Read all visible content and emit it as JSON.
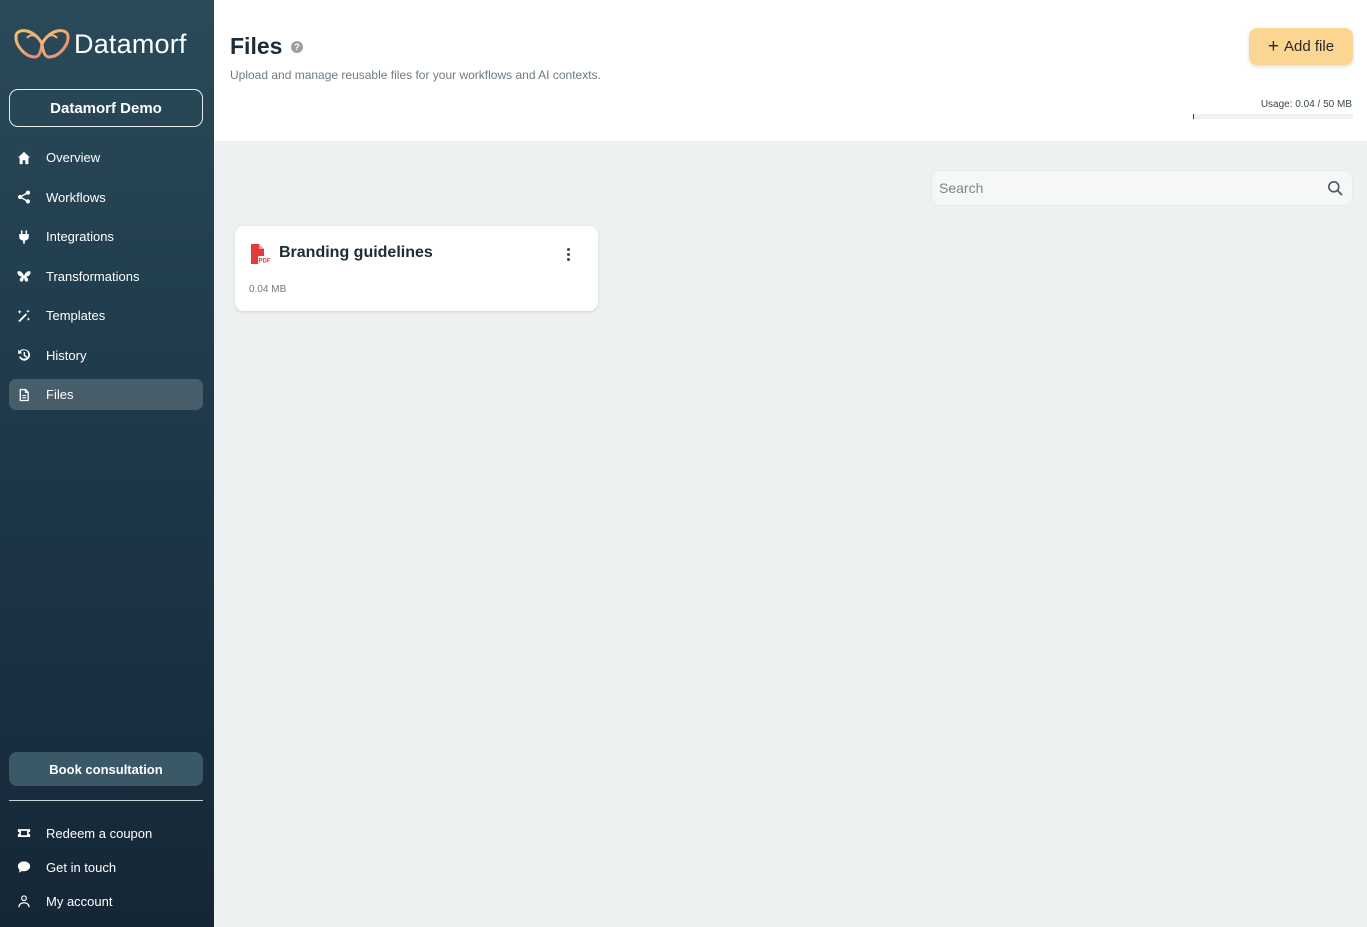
{
  "app": {
    "name": "Datamorf"
  },
  "organization": {
    "name": "Datamorf Demo"
  },
  "sidebar": {
    "items": [
      {
        "label": "Overview",
        "icon": "home-icon"
      },
      {
        "label": "Workflows",
        "icon": "share-icon"
      },
      {
        "label": "Integrations",
        "icon": "plug-icon"
      },
      {
        "label": "Transformations",
        "icon": "butterfly-icon"
      },
      {
        "label": "Templates",
        "icon": "magic-wand-icon"
      },
      {
        "label": "History",
        "icon": "history-icon"
      },
      {
        "label": "Files",
        "icon": "file-icon",
        "active": true
      }
    ],
    "book_label": "Book consultation",
    "bottom_items": [
      {
        "label": "Redeem a coupon",
        "icon": "ticket-icon"
      },
      {
        "label": "Get in touch",
        "icon": "chat-icon"
      },
      {
        "label": "My account",
        "icon": "user-icon"
      }
    ]
  },
  "header": {
    "title": "Files",
    "help": "?",
    "subtitle": "Upload and manage reusable files for your workflows and AI contexts.",
    "add_label": "Add file",
    "usage_label": "Usage: 0.04 / 50 MB",
    "usage_fraction": 0.0008
  },
  "search": {
    "placeholder": "Search"
  },
  "files": [
    {
      "name": "Branding guidelines",
      "size": "0.04 MB",
      "type": "pdf"
    }
  ],
  "colors": {
    "accent": "#fbd592",
    "sidebar": "#1f3a4a",
    "pdf": "#e23b3b"
  }
}
